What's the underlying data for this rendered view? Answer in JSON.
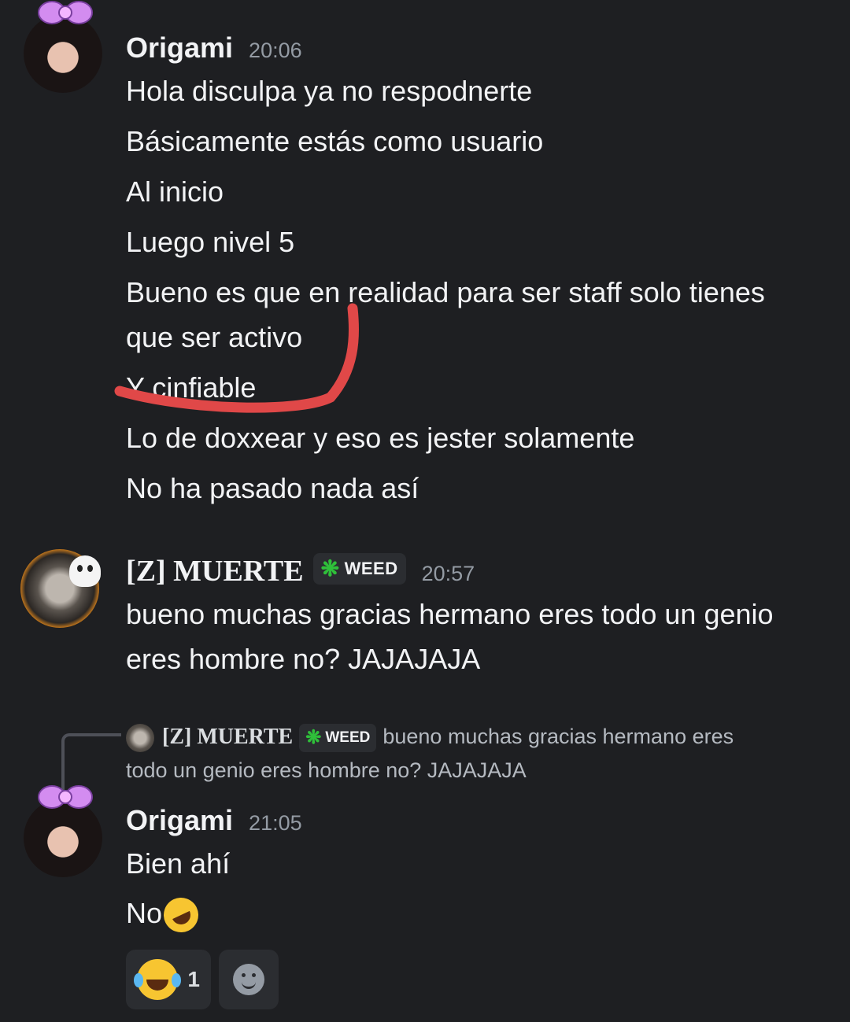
{
  "messages": [
    {
      "author": "Origami",
      "time": "20:06",
      "lines": [
        "Hola disculpa ya no respodnerte",
        "Básicamente estás como usuario",
        "Al inicio",
        "Luego nivel 5",
        "Bueno es que en realidad para ser staff solo tienes",
        "que ser activo",
        "Y cinfiable",
        "Lo de doxxear y eso es jester solamente",
        "No ha pasado nada así"
      ]
    },
    {
      "author": "[Z] MUERTE",
      "badge": "WEED",
      "time": "20:57",
      "lines": [
        "bueno muchas gracias hermano eres todo un genio",
        "eres hombre no? JAJAJAJA"
      ]
    },
    {
      "reply_to": {
        "author": "[Z] MUERTE",
        "badge": "WEED",
        "text_line1": "bueno muchas gracias hermano eres",
        "text_line2": "todo un genio eres hombre no? JAJAJAJA"
      },
      "author": "Origami",
      "time": "21:05",
      "lines": [
        "Bien ahí",
        "No"
      ],
      "reactions": [
        {
          "emoji": "joy",
          "count": "1"
        }
      ]
    }
  ],
  "icons": {
    "badge_leaf": "cannabis-leaf-icon",
    "add_reaction": "add-reaction-smile-icon",
    "inline_emoji": "rofl-emoji"
  },
  "colors": {
    "background": "#1e1f22",
    "annotation_stroke": "#e04848",
    "badge_leaf": "#2fbf3a",
    "timestamp": "#949ba4"
  }
}
